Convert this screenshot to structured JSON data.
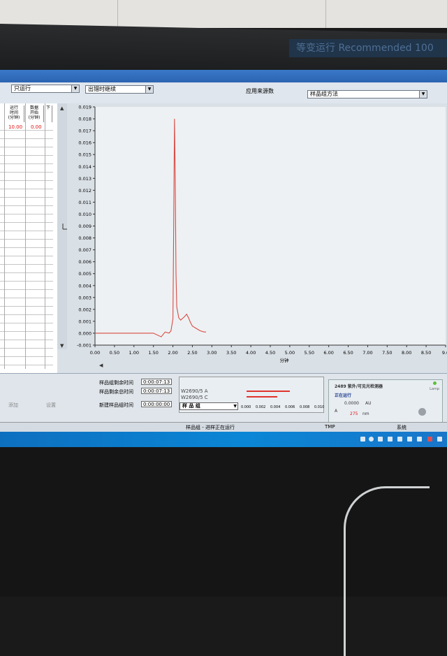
{
  "toolbar": {
    "run_mode": "只运行",
    "error_action": "出错时继续",
    "apply_label": "应用来源数",
    "method_combo": "样品组方法"
  },
  "sample_table": {
    "columns": [
      "运行\n时间\n(分钟)",
      "数据\n开始\n(分钟)",
      "下"
    ],
    "rows": [
      [
        "10.00",
        "0.00"
      ]
    ]
  },
  "chart_data": {
    "type": "line",
    "xlabel": "分钟",
    "ylabel": "",
    "xlim": [
      0,
      9.0
    ],
    "ylim": [
      -0.001,
      0.019
    ],
    "x_ticks": [
      "0.00",
      "0.50",
      "1.00",
      "1.50",
      "2.00",
      "2.50",
      "3.00",
      "3.50",
      "4.00",
      "4.50",
      "5.00",
      "5.50",
      "6.00",
      "6.50",
      "7.00",
      "7.50",
      "8.00",
      "8.50",
      "9.0"
    ],
    "y_ticks": [
      "0.019",
      "0.018",
      "0.017",
      "0.016",
      "0.015",
      "0.014",
      "0.013",
      "0.012",
      "0.011",
      "0.010",
      "0.009",
      "0.008",
      "0.007",
      "0.006",
      "0.005",
      "0.004",
      "0.003",
      "0.002",
      "0.001",
      "0.000",
      "-0.001"
    ],
    "series": [
      {
        "color": "#d94b45",
        "x": [
          0.0,
          0.5,
          1.0,
          1.5,
          1.7,
          1.8,
          1.9,
          1.95,
          2.0,
          2.02,
          2.04,
          2.06,
          2.08,
          2.1,
          2.15,
          2.2,
          2.3,
          2.35,
          2.4,
          2.45,
          2.5,
          2.6,
          2.7,
          2.8,
          2.85
        ],
        "y": [
          0.0,
          0.0,
          0.0,
          0.0,
          -0.0003,
          0.0001,
          0.0,
          0.0002,
          0.0012,
          0.009,
          0.018,
          0.013,
          0.005,
          0.0022,
          0.0013,
          0.0011,
          0.0014,
          0.0016,
          0.0013,
          0.0009,
          0.0006,
          0.0004,
          0.0002,
          0.0001,
          0.0001
        ]
      }
    ]
  },
  "bottom": {
    "timers": [
      {
        "label": "样品组剩余时间",
        "value": "0:00:07:13"
      },
      {
        "label": "样品剩余总时间",
        "value": "0:00:07:13"
      },
      {
        "label": "新建样品组时间",
        "value": "0:00:00:00"
      }
    ],
    "channels": [
      "W2690/5 A",
      "W2690/5 C"
    ],
    "combo_value": "样 品 组",
    "mini_ticks": [
      "0.000",
      "0.002",
      "0.004",
      "0.006",
      "0.008",
      "0.010"
    ],
    "left_buttons": [
      "添加",
      "设置"
    ]
  },
  "detector": {
    "title": "2489 紫外/可见光检测器",
    "status": "正在运行",
    "value": "0.0000",
    "value_unit": "AU",
    "channel": "A",
    "wavelength": "275",
    "wl_unit": "nm",
    "lamp_label": "Lamp"
  },
  "statusbar": {
    "message": "样品组 - 进样正在运行",
    "tmp": "TMP",
    "right": "系统"
  },
  "faint_banner": "等变运行 Recommended 100"
}
